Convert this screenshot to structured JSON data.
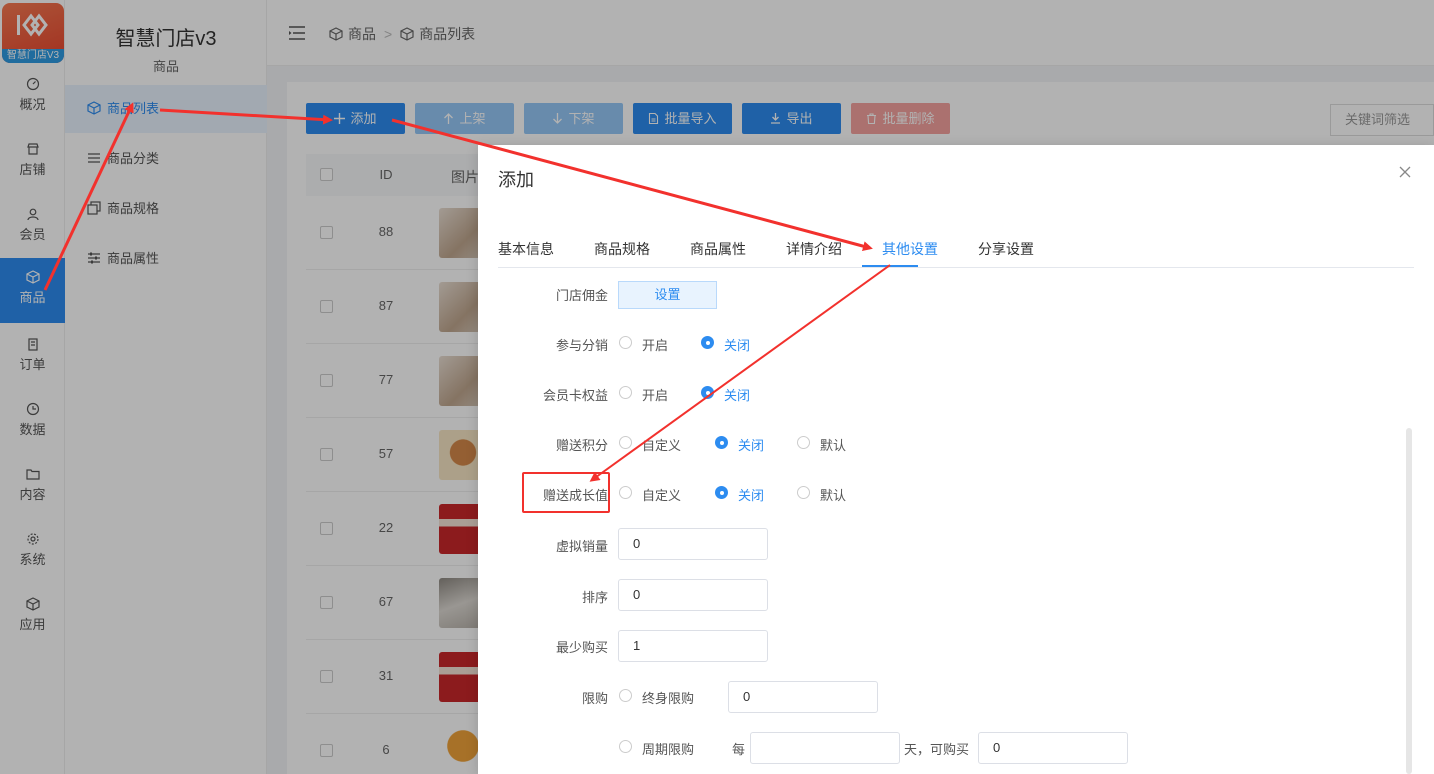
{
  "app": {
    "logo_text": "智慧门店V3",
    "title": "智慧门店v3",
    "section_caption": "商品"
  },
  "rail": [
    {
      "key": "overview",
      "label": "概况",
      "icon": "dashboard-icon"
    },
    {
      "key": "store",
      "label": "店铺",
      "icon": "store-icon"
    },
    {
      "key": "member",
      "label": "会员",
      "icon": "user-icon"
    },
    {
      "key": "goods",
      "label": "商品",
      "icon": "box-icon",
      "active": true
    },
    {
      "key": "order",
      "label": "订单",
      "icon": "clipboard-icon"
    },
    {
      "key": "data",
      "label": "数据",
      "icon": "clock-icon"
    },
    {
      "key": "content",
      "label": "内容",
      "icon": "folder-icon"
    },
    {
      "key": "system",
      "label": "系统",
      "icon": "gear-icon"
    },
    {
      "key": "app",
      "label": "应用",
      "icon": "cube-icon"
    }
  ],
  "sidebar": [
    {
      "label": "商品列表",
      "icon": "box-icon",
      "active": true
    },
    {
      "label": "商品分类",
      "icon": "list-icon"
    },
    {
      "label": "商品规格",
      "icon": "copy-icon"
    },
    {
      "label": "商品属性",
      "icon": "sliders-icon"
    }
  ],
  "breadcrumb": {
    "first": "商品",
    "separator": ">",
    "second": "商品列表"
  },
  "toolbar": {
    "add": "添加",
    "up": "上架",
    "down": "下架",
    "import": "批量导入",
    "export": "导出",
    "batch_delete": "批量删除",
    "keyword_filter": "关键词筛选"
  },
  "table": {
    "headers": {
      "id": "ID",
      "image": "图片"
    },
    "ids": [
      "88",
      "87",
      "77",
      "57",
      "22",
      "67",
      "31",
      "6"
    ]
  },
  "modal": {
    "title": "添加",
    "tabs": [
      "基本信息",
      "商品规格",
      "商品属性",
      "详情介绍",
      "其他设置",
      "分享设置"
    ],
    "active_tab": "其他设置",
    "fields": {
      "commission_label": "门店佣金",
      "commission_button": "设置",
      "distribution_label": "参与分销",
      "membercard_label": "会员卡权益",
      "points_label": "赠送积分",
      "growth_label": "赠送成长值",
      "virtual_sales_label": "虚拟销量",
      "virtual_sales_value": "0",
      "sort_label": "排序",
      "sort_value": "0",
      "min_buy_label": "最少购买",
      "min_buy_value": "1",
      "limit_label": "限购",
      "lifetime_limit": "终身限购",
      "lifetime_value": "0",
      "period_limit": "周期限购",
      "every": "每",
      "days_can_buy": "天，可购买",
      "period_value": "0"
    },
    "options": {
      "on": "开启",
      "off": "关闭",
      "custom": "自定义",
      "default": "默认"
    }
  },
  "colors": {
    "primary": "#2d8cf0",
    "danger": "#ed4014",
    "annotation": "#f2312d"
  }
}
